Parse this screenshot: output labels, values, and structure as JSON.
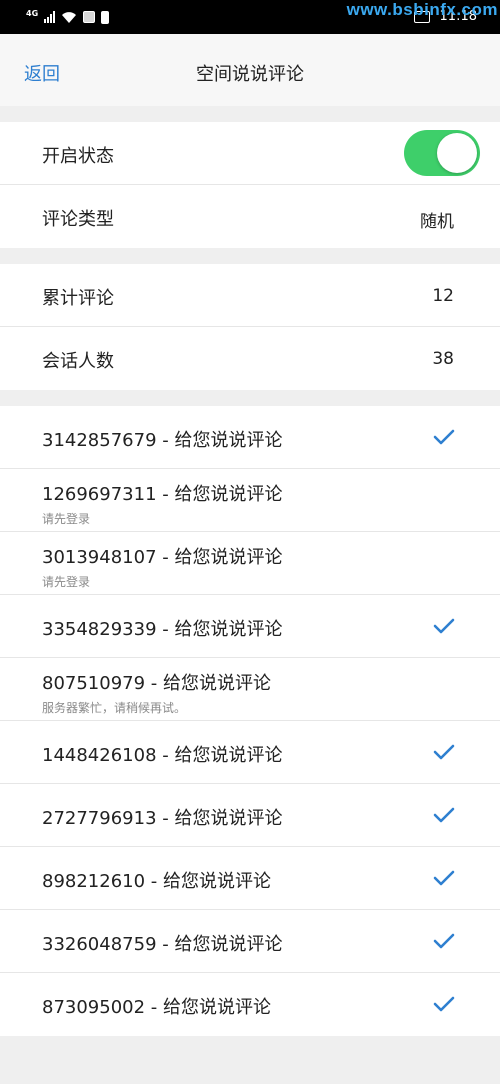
{
  "status_bar": {
    "signal_label": "4G",
    "watermark": "www.bsbinfx.com",
    "time": "11:18"
  },
  "nav": {
    "back_label": "返回",
    "title": "空间说说评论"
  },
  "settings": {
    "enable_label": "开启状态",
    "enabled": true,
    "comment_type_label": "评论类型",
    "comment_type_value": "随机"
  },
  "stats": {
    "total_label": "累计评论",
    "total_value": "12",
    "sessions_label": "会话人数",
    "sessions_value": "38"
  },
  "comments": [
    {
      "title": "3142857679 - 给您说说评论",
      "sub": "",
      "checked": true
    },
    {
      "title": "1269697311 - 给您说说评论",
      "sub": "请先登录",
      "checked": false
    },
    {
      "title": "3013948107 - 给您说说评论",
      "sub": "请先登录",
      "checked": false
    },
    {
      "title": "3354829339 - 给您说说评论",
      "sub": "",
      "checked": true
    },
    {
      "title": "807510979 - 给您说说评论",
      "sub": "服务器繁忙，请稍候再试。",
      "checked": false
    },
    {
      "title": "1448426108 - 给您说说评论",
      "sub": "",
      "checked": true
    },
    {
      "title": "2727796913 - 给您说说评论",
      "sub": "",
      "checked": true
    },
    {
      "title": "898212610 - 给您说说评论",
      "sub": "",
      "checked": true
    },
    {
      "title": "3326048759 - 给您说说评论",
      "sub": "",
      "checked": true
    },
    {
      "title": "873095002 - 给您说说评论",
      "sub": "",
      "checked": true
    }
  ],
  "colors": {
    "accent": "#2e7fd0",
    "toggle_on": "#3ecf6a",
    "watermark": "#3ba9f0"
  }
}
